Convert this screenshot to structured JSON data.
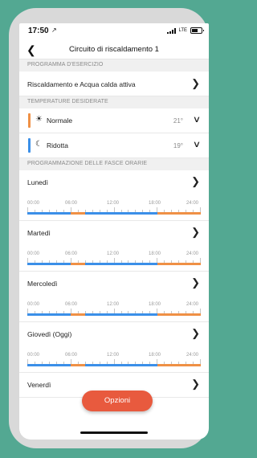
{
  "status_bar": {
    "time": "17:50",
    "location_glyph": "↗",
    "network": "LTE"
  },
  "nav": {
    "back_icon": "chevron-left-icon",
    "back_glyph": "❮",
    "title": "Circuito di riscaldamento 1"
  },
  "sections": {
    "program": "PROGRAMMA D'ESERCIZIO",
    "temps": "TEMPERATURE DESIDERATE",
    "schedule": "PROGRAMMAZIONE DELLE FASCE ORARIE"
  },
  "program": {
    "label": "Riscaldamento e Acqua calda attiva"
  },
  "temperatures": [
    {
      "label": "Normale",
      "value": "21°",
      "color": "#ef9045",
      "icon": "sun-icon",
      "glyph": "☀"
    },
    {
      "label": "Ridotta",
      "value": "19°",
      "color": "#3b8fe8",
      "icon": "moon-icon",
      "glyph": "☾"
    }
  ],
  "hour_labels": [
    "00:00",
    "06:00",
    "12:00",
    "18:00",
    "24:00"
  ],
  "days": [
    {
      "name": "Lunedì",
      "segments": [
        [
          6,
          8
        ],
        [
          18,
          24
        ]
      ]
    },
    {
      "name": "Martedì",
      "segments": [
        [
          6,
          8
        ],
        [
          18,
          24
        ]
      ]
    },
    {
      "name": "Mercoledì",
      "segments": [
        [
          6,
          8
        ],
        [
          18,
          24
        ]
      ]
    },
    {
      "name": "Giovedì (Oggi)",
      "segments": [
        [
          6,
          8
        ],
        [
          18,
          24
        ]
      ]
    },
    {
      "name": "Venerdì",
      "segments": []
    }
  ],
  "colors": {
    "comfort": "#ef9045",
    "reduced": "#3b8fe8",
    "accent": "#e85a3e"
  },
  "options_button": "Opzioni",
  "chevron_glyph": "❯",
  "dropdown_glyph": "∨"
}
